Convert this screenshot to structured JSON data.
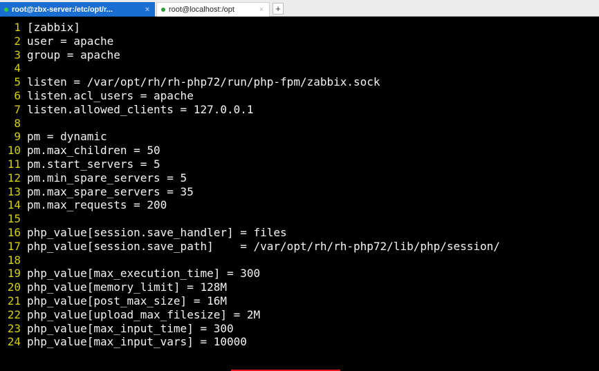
{
  "tabs": [
    {
      "title": "root@zbx-server:/etc/opt/r...",
      "close": "×",
      "active": true
    },
    {
      "title": "root@localhost:/opt",
      "close": "×",
      "active": false
    }
  ],
  "new_tab_label": "+",
  "colors": {
    "active_tab": "#1b6ed1",
    "line_numbers": "#d5d000",
    "text": "#f4f4f4",
    "background": "#000000"
  },
  "editor": {
    "lines": [
      {
        "n": "1",
        "text": "[zabbix]"
      },
      {
        "n": "2",
        "text": "user = apache"
      },
      {
        "n": "3",
        "text": "group = apache"
      },
      {
        "n": "4",
        "text": ""
      },
      {
        "n": "5",
        "text": "listen = /var/opt/rh/rh-php72/run/php-fpm/zabbix.sock"
      },
      {
        "n": "6",
        "text": "listen.acl_users = apache"
      },
      {
        "n": "7",
        "text": "listen.allowed_clients = 127.0.0.1"
      },
      {
        "n": "8",
        "text": ""
      },
      {
        "n": "9",
        "text": "pm = dynamic"
      },
      {
        "n": "10",
        "text": "pm.max_children = 50"
      },
      {
        "n": "11",
        "text": "pm.start_servers = 5"
      },
      {
        "n": "12",
        "text": "pm.min_spare_servers = 5"
      },
      {
        "n": "13",
        "text": "pm.max_spare_servers = 35"
      },
      {
        "n": "14",
        "text": "pm.max_requests = 200"
      },
      {
        "n": "15",
        "text": ""
      },
      {
        "n": "16",
        "text": "php_value[session.save_handler] = files"
      },
      {
        "n": "17",
        "text": "php_value[session.save_path]    = /var/opt/rh/rh-php72/lib/php/session/"
      },
      {
        "n": "18",
        "text": ""
      },
      {
        "n": "19",
        "text": "php_value[max_execution_time] = 300"
      },
      {
        "n": "20",
        "text": "php_value[memory_limit] = 128M"
      },
      {
        "n": "21",
        "text": "php_value[post_max_size] = 16M"
      },
      {
        "n": "22",
        "text": "php_value[upload_max_filesize] = 2M"
      },
      {
        "n": "23",
        "text": "php_value[max_input_time] = 300"
      },
      {
        "n": "24",
        "text": "php_value[max_input_vars] = 10000"
      }
    ]
  }
}
